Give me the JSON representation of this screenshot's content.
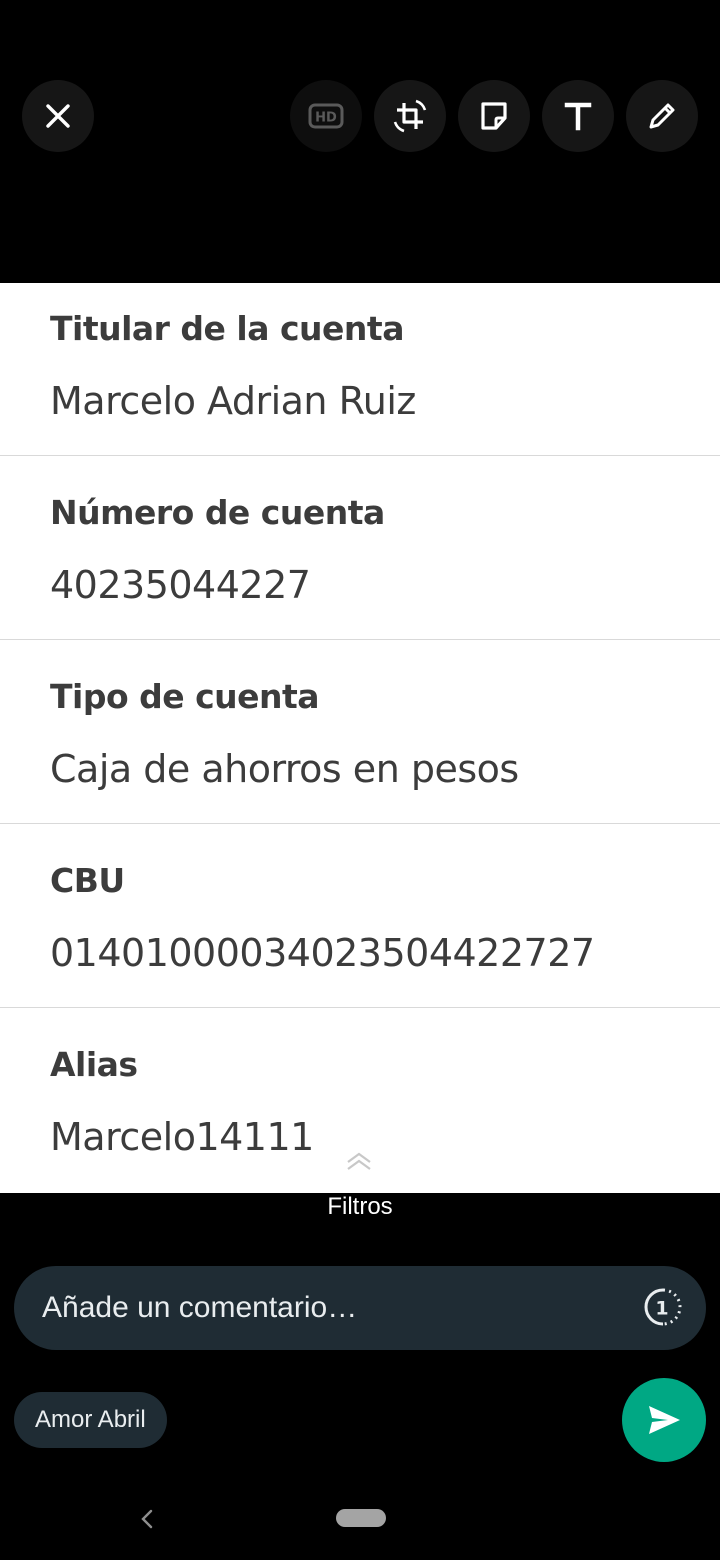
{
  "toolbar": {
    "close_icon": "close-icon",
    "hd_icon": "hd-icon",
    "crop_rotate_icon": "crop-rotate-icon",
    "sticker_icon": "sticker-icon",
    "text_icon": "text-icon",
    "pencil_icon": "pencil-icon"
  },
  "image": {
    "fields": [
      {
        "label": "Titular de la cuenta",
        "value": "Marcelo Adrian Ruiz"
      },
      {
        "label": "Número de cuenta",
        "value": "40235044227"
      },
      {
        "label": "Tipo de cuenta",
        "value": "Caja de ahorros en pesos"
      },
      {
        "label": "CBU",
        "value": "01401000034023504422727"
      },
      {
        "label": "Alias",
        "value": "Marcelo14111"
      }
    ]
  },
  "filters": {
    "label": "Filtros"
  },
  "composer": {
    "placeholder": "Añade un comentario…",
    "view_once_label": "1"
  },
  "recipient": {
    "name": "Amor Abril"
  },
  "colors": {
    "send_button": "#00a884",
    "composer_bg": "#1f2c34",
    "background": "#000000"
  }
}
